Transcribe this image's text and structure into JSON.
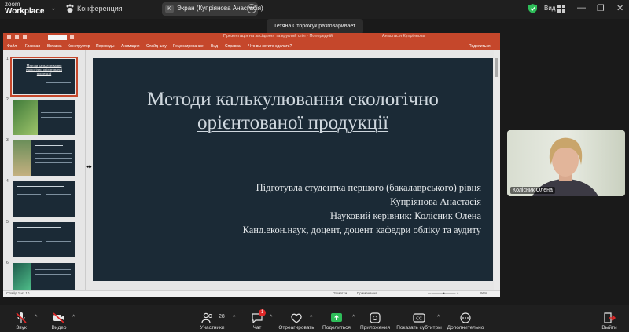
{
  "topbar": {
    "logo_line1": "zoom",
    "logo_line2": "Workplace",
    "meeting_label": "Конференция",
    "screen_share_label": "Экран (Купріянова Анастасія)",
    "screen_share_initial": "K",
    "view_label": "Вид"
  },
  "toast": {
    "text": "Тетяна Сторожук разговаривает..."
  },
  "powerpoint": {
    "window_title": "Презентація на засідання та круглий стіл · Попередній",
    "user_name": "Анастасія Купріянова",
    "ribbon": [
      "Файл",
      "Главная",
      "Вставка",
      "Конструктор",
      "Переходы",
      "Анимация",
      "Слайд-шоу",
      "Рецензирование",
      "Вид",
      "Справка",
      "Что вы хотите сделать?",
      "Поделиться"
    ],
    "thumbnail_numbers": [
      "1",
      "2",
      "3",
      "4",
      "5",
      "6"
    ],
    "thumbnail_title": "Методи калькулювання екологічно орієнтованої продукції",
    "slide": {
      "title": "Методи калькулювання екологічно орієнтованої продукції",
      "author_lines": [
        "Підготувла студентка першого (бакалаврського) рівня",
        "Купріянова Анастасія",
        "Науковий керівник: Колісник Олена",
        "Канд.екон.наук, доцент, доцент кафедри обліку та аудиту"
      ]
    },
    "status": {
      "slide_counter": "Слайд 1 из 10",
      "notes": "Заметки",
      "comments": "Примечания",
      "zoom": "96%"
    }
  },
  "video": {
    "participant_name": "Колісник Олена"
  },
  "toolbar": {
    "audio_label": "Звук",
    "video_label": "Видео",
    "participants_label": "Участники",
    "participants_count": "28",
    "chat_label": "Чат",
    "chat_badge": "1",
    "react_label": "Отреагировать",
    "share_label": "Поделиться",
    "apps_label": "Приложения",
    "captions_label": "Показать субтитры",
    "more_label": "Дополнительно",
    "leave_label": "Выйти"
  },
  "colors": {
    "ppt_accent": "#c5472b",
    "slide_bg": "#1b2a36",
    "share_green": "#2ebd59",
    "mute_red": "#e02828"
  }
}
